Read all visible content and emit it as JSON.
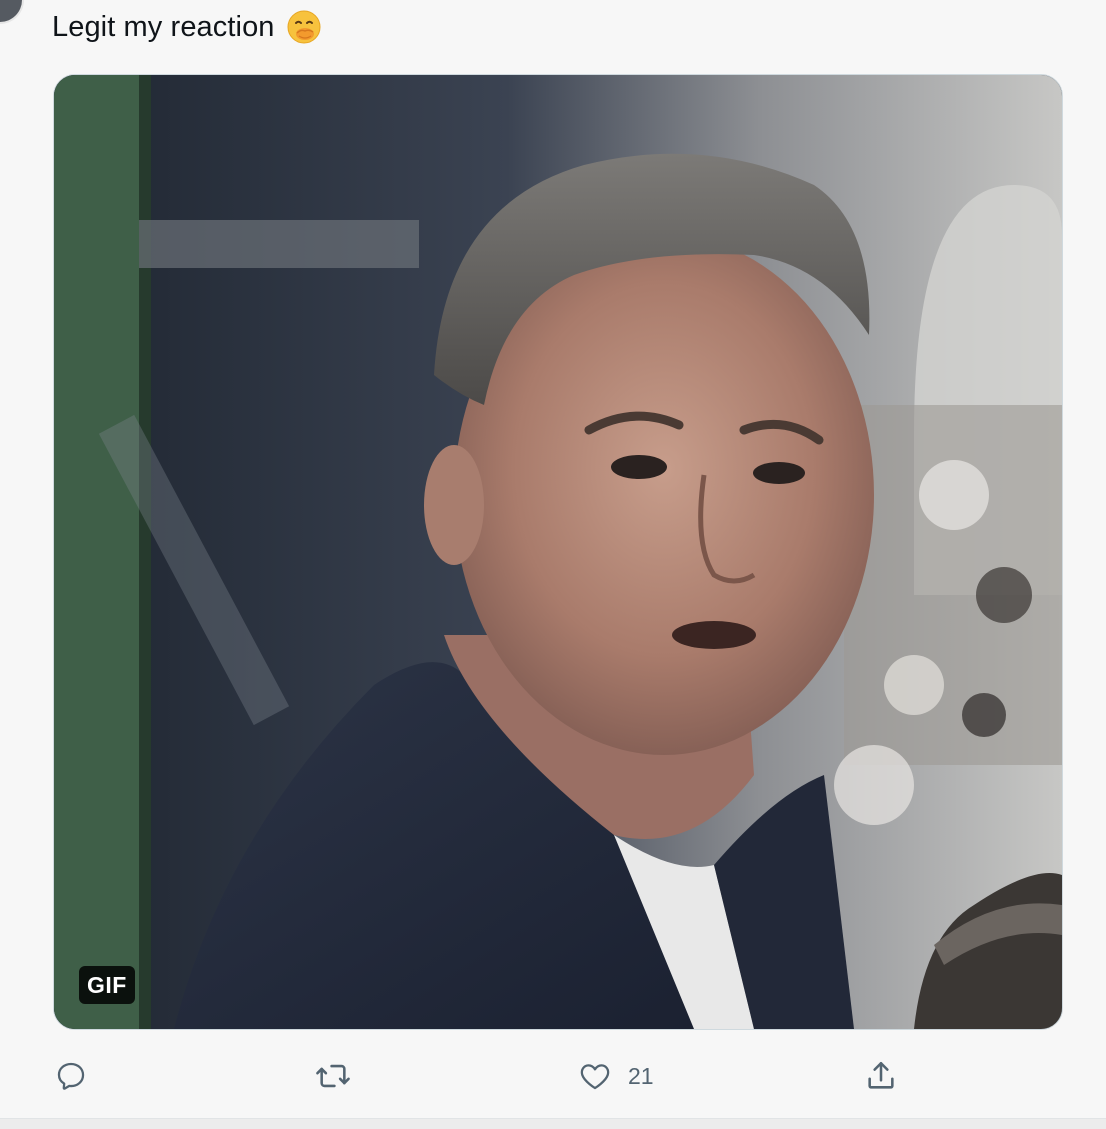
{
  "tweet": {
    "text": "Legit my reaction",
    "emoji_icon": "hand-over-mouth-emoji-icon"
  },
  "media": {
    "badge": "GIF",
    "description_icon": "gif-media-icon"
  },
  "actions": {
    "reply_icon": "reply-icon",
    "retweet_icon": "retweet-icon",
    "like_icon": "heart-icon",
    "like_count": "21",
    "share_icon": "share-icon"
  },
  "colors": {
    "text": "#0f1419",
    "muted": "#536471",
    "background": "#f7f7f7",
    "card_border": "#cfd9de"
  }
}
